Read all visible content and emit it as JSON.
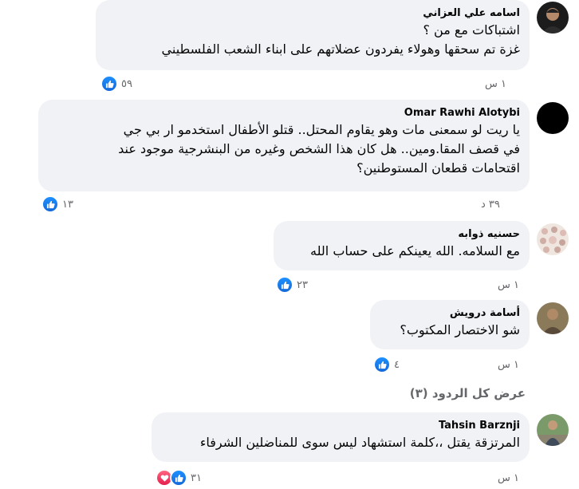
{
  "comments": [
    {
      "author": "اسامه علي العزاني",
      "lines": [
        "اشتباكات مع من ؟",
        "غزة تم سحقها وهولاء يفردون عضلاتهم على ابناء الشعب الفلسطيني"
      ],
      "time": "١ س",
      "reactions": "٥٩"
    },
    {
      "author": "Omar Rawhi Alotybi",
      "lines": [
        "يا ريت لو سمعنى مات وهو يقاوم المحتل.. قتلو الأطفال استخدمو ار بي جي",
        "في قصف المقا.ومين.. هل كان هذا الشخص وغيره من البنشرجية موجود عند",
        "اقتحامات قطعان المستوطنين؟"
      ],
      "time": "٣٩ د",
      "reactions": "١٣"
    },
    {
      "author": "حسنيه ذوابه",
      "lines": [
        "مع السلامه. الله يعينكم على حساب الله"
      ],
      "time": "١ س",
      "reactions": "٢٣"
    },
    {
      "author": "أسامة درويش",
      "lines": [
        "شو الاختصار المكتوب؟"
      ],
      "time": "١ س",
      "reactions": "٤"
    },
    {
      "author": "Tahsin Barznji",
      "lines": [
        "المرتزقة يقتل ،،كلمة استشهاد ليس سوى للمناضلين الشرفاء"
      ],
      "time": "١ س",
      "reactions": "٣١"
    }
  ],
  "view_replies": "عرض كل الردود (٣)",
  "colors": {
    "bubble": "#f0f2f5",
    "meta": "#65676b",
    "like": "#1877f2",
    "love": "#f33e58"
  }
}
